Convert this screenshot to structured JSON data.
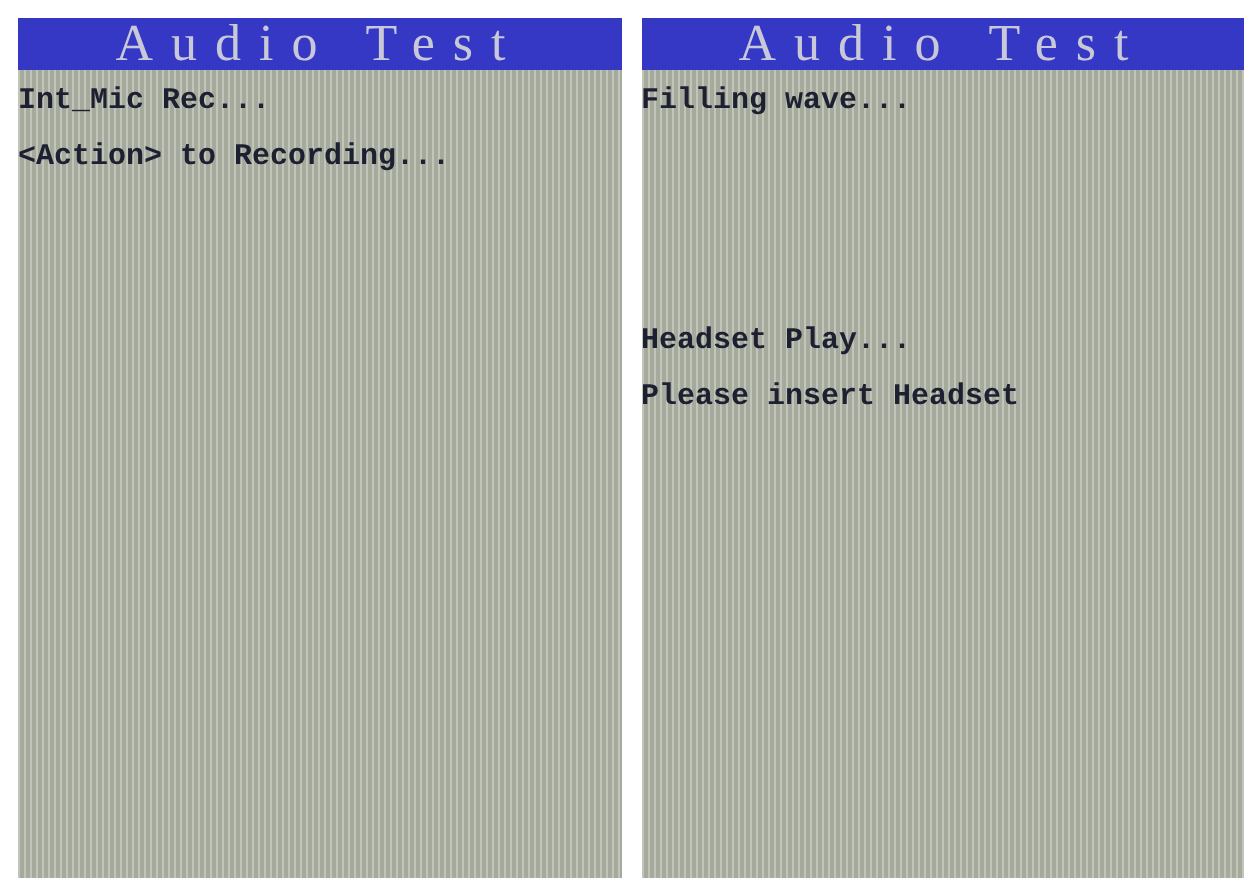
{
  "screens": [
    {
      "title": "Audio Test",
      "sections": [
        {
          "lines": [
            "Int_Mic Rec...",
            "<Action> to Recording..."
          ]
        }
      ]
    },
    {
      "title": "Audio Test",
      "sections": [
        {
          "lines": [
            "Filling wave..."
          ]
        },
        {
          "lines": [
            "Headset Play...",
            "Please insert Headset"
          ]
        }
      ]
    }
  ]
}
